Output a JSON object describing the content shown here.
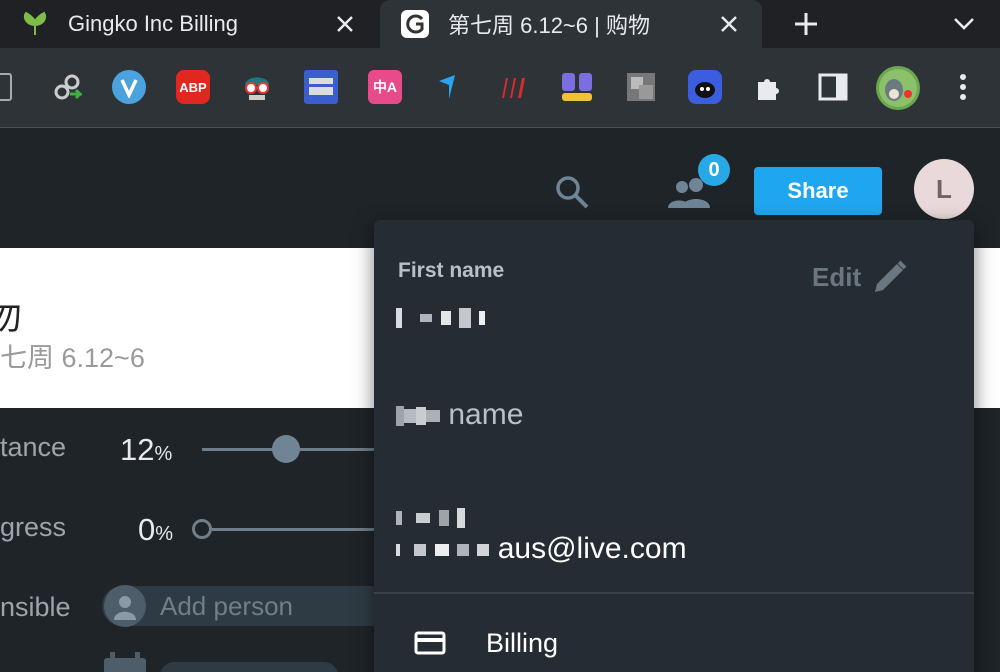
{
  "browser": {
    "tabs": [
      {
        "title": "Gingko Inc Billing",
        "icon": "ginkgo-leaf-icon",
        "active": false
      },
      {
        "title": "第七周 6.12~6 | 购物",
        "icon": "gingko-g-icon",
        "active": true
      }
    ],
    "toolbar_extensions": [
      "window-icon",
      "link-arrow-icon",
      "v-circle-icon",
      "abp-icon",
      "robot-glasses-icon",
      "panel-icon",
      "translate-icon",
      "cursor-blue-icon",
      "red-stripes-icon",
      "blocks-icon",
      "dictionary-icon",
      "blue-face-icon",
      "puzzle-icon",
      "sidepanel-icon",
      "totoro-avatar-icon",
      "menu-dots-icon"
    ],
    "extension_labels": {
      "abp": "ABP",
      "translate": "中A"
    }
  },
  "header": {
    "search_icon": "search-icon",
    "people_icon": "people-icon",
    "collaborator_count": "0",
    "share_label": "Share",
    "avatar_initial": "L"
  },
  "card": {
    "title_partial": "勿",
    "subtitle_partial": "七周 6.12~6"
  },
  "form": {
    "importance_label": "tance",
    "importance_value": "12",
    "importance_unit": "%",
    "importance_level": 0.12,
    "progress_label": "gress",
    "progress_value": "0",
    "progress_unit": "%",
    "responsible_label": "nsible",
    "add_person_placeholder": "Add person"
  },
  "profile_menu": {
    "first_name_label": "First name",
    "edit_label": "Edit",
    "last_name_label_visible": "name",
    "email_visible": "aus@live.com",
    "billing_label": "Billing"
  },
  "colors": {
    "accent": "#1ea7f0",
    "badge": "#28a9e6",
    "panel": "#252c33",
    "background": "#1f2428"
  }
}
